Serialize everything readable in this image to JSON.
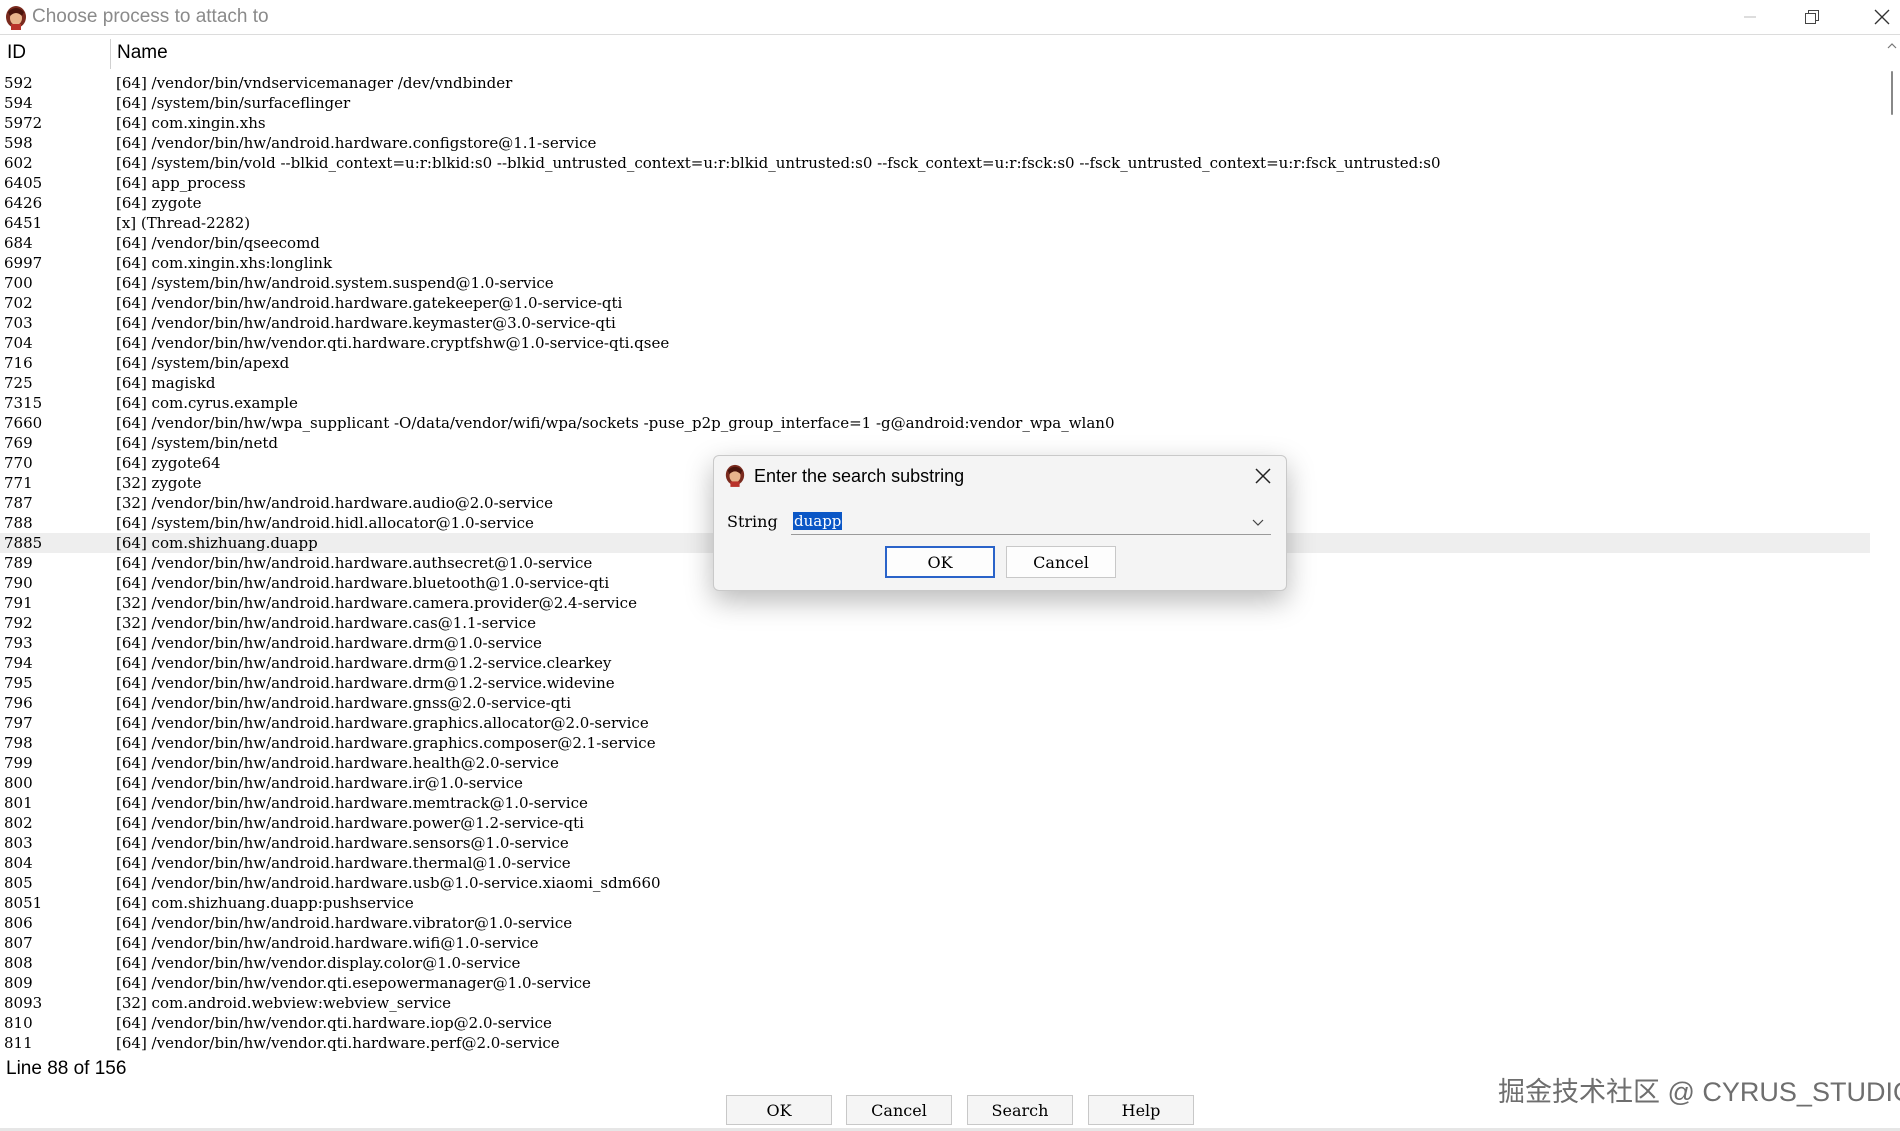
{
  "window": {
    "title": "Choose process to attach to"
  },
  "list": {
    "headers": {
      "id": "ID",
      "name": "Name"
    },
    "rows": [
      {
        "id": "592",
        "name": "[64] /vendor/bin/vndservicemanager /dev/vndbinder"
      },
      {
        "id": "594",
        "name": "[64] /system/bin/surfaceflinger"
      },
      {
        "id": "5972",
        "name": "[64] com.xingin.xhs"
      },
      {
        "id": "598",
        "name": "[64] /vendor/bin/hw/android.hardware.configstore@1.1-service"
      },
      {
        "id": "602",
        "name": "[64] /system/bin/vold --blkid_context=u:r:blkid:s0 --blkid_untrusted_context=u:r:blkid_untrusted:s0 --fsck_context=u:r:fsck:s0 --fsck_untrusted_context=u:r:fsck_untrusted:s0"
      },
      {
        "id": "6405",
        "name": "[64] app_process"
      },
      {
        "id": "6426",
        "name": "[64] zygote"
      },
      {
        "id": "6451",
        "name": "[x] (Thread-2282)"
      },
      {
        "id": "684",
        "name": "[64] /vendor/bin/qseecomd"
      },
      {
        "id": "6997",
        "name": "[64] com.xingin.xhs:longlink"
      },
      {
        "id": "700",
        "name": "[64] /system/bin/hw/android.system.suspend@1.0-service"
      },
      {
        "id": "702",
        "name": "[64] /vendor/bin/hw/android.hardware.gatekeeper@1.0-service-qti"
      },
      {
        "id": "703",
        "name": "[64] /vendor/bin/hw/android.hardware.keymaster@3.0-service-qti"
      },
      {
        "id": "704",
        "name": "[64] /vendor/bin/hw/vendor.qti.hardware.cryptfshw@1.0-service-qti.qsee"
      },
      {
        "id": "716",
        "name": "[64] /system/bin/apexd"
      },
      {
        "id": "725",
        "name": "[64] magiskd"
      },
      {
        "id": "7315",
        "name": "[64] com.cyrus.example"
      },
      {
        "id": "7660",
        "name": "[64] /vendor/bin/hw/wpa_supplicant -O/data/vendor/wifi/wpa/sockets -puse_p2p_group_interface=1 -g@android:vendor_wpa_wlan0"
      },
      {
        "id": "769",
        "name": "[64] /system/bin/netd"
      },
      {
        "id": "770",
        "name": "[64] zygote64"
      },
      {
        "id": "771",
        "name": "[32] zygote"
      },
      {
        "id": "787",
        "name": "[32] /vendor/bin/hw/android.hardware.audio@2.0-service"
      },
      {
        "id": "788",
        "name": "[64] /system/bin/hw/android.hidl.allocator@1.0-service"
      },
      {
        "id": "7885",
        "name": "[64] com.shizhuang.duapp",
        "selected": true
      },
      {
        "id": "789",
        "name": "[64] /vendor/bin/hw/android.hardware.authsecret@1.0-service"
      },
      {
        "id": "790",
        "name": "[64] /vendor/bin/hw/android.hardware.bluetooth@1.0-service-qti"
      },
      {
        "id": "791",
        "name": "[32] /vendor/bin/hw/android.hardware.camera.provider@2.4-service"
      },
      {
        "id": "792",
        "name": "[32] /vendor/bin/hw/android.hardware.cas@1.1-service"
      },
      {
        "id": "793",
        "name": "[64] /vendor/bin/hw/android.hardware.drm@1.0-service"
      },
      {
        "id": "794",
        "name": "[64] /vendor/bin/hw/android.hardware.drm@1.2-service.clearkey"
      },
      {
        "id": "795",
        "name": "[64] /vendor/bin/hw/android.hardware.drm@1.2-service.widevine"
      },
      {
        "id": "796",
        "name": "[64] /vendor/bin/hw/android.hardware.gnss@2.0-service-qti"
      },
      {
        "id": "797",
        "name": "[64] /vendor/bin/hw/android.hardware.graphics.allocator@2.0-service"
      },
      {
        "id": "798",
        "name": "[64] /vendor/bin/hw/android.hardware.graphics.composer@2.1-service"
      },
      {
        "id": "799",
        "name": "[64] /vendor/bin/hw/android.hardware.health@2.0-service"
      },
      {
        "id": "800",
        "name": "[64] /vendor/bin/hw/android.hardware.ir@1.0-service"
      },
      {
        "id": "801",
        "name": "[64] /vendor/bin/hw/android.hardware.memtrack@1.0-service"
      },
      {
        "id": "802",
        "name": "[64] /vendor/bin/hw/android.hardware.power@1.2-service-qti"
      },
      {
        "id": "803",
        "name": "[64] /vendor/bin/hw/android.hardware.sensors@1.0-service"
      },
      {
        "id": "804",
        "name": "[64] /vendor/bin/hw/android.hardware.thermal@1.0-service"
      },
      {
        "id": "805",
        "name": "[64] /vendor/bin/hw/android.hardware.usb@1.0-service.xiaomi_sdm660"
      },
      {
        "id": "8051",
        "name": "[64] com.shizhuang.duapp:pushservice"
      },
      {
        "id": "806",
        "name": "[64] /vendor/bin/hw/android.hardware.vibrator@1.0-service"
      },
      {
        "id": "807",
        "name": "[64] /vendor/bin/hw/android.hardware.wifi@1.0-service"
      },
      {
        "id": "808",
        "name": "[64] /vendor/bin/hw/vendor.display.color@1.0-service"
      },
      {
        "id": "809",
        "name": "[64] /vendor/bin/hw/vendor.qti.esepowermanager@1.0-service"
      },
      {
        "id": "8093",
        "name": "[32] com.android.webview:webview_service"
      },
      {
        "id": "810",
        "name": "[64] /vendor/bin/hw/vendor.qti.hardware.iop@2.0-service"
      },
      {
        "id": "811",
        "name": "[64] /vendor/bin/hw/vendor.qti.hardware.perf@2.0-service"
      }
    ]
  },
  "status": {
    "line_text": "Line 88 of 156"
  },
  "buttons": {
    "ok": "OK",
    "cancel": "Cancel",
    "search": "Search",
    "help": "Help"
  },
  "dialog": {
    "title": "Enter the search substring",
    "string_label": "String",
    "string_value": "duapp",
    "ok": "OK",
    "cancel": "Cancel"
  },
  "watermark": "掘金技术社区 @ CYRUS_STUDIO",
  "colors": {
    "selection": "#0b57c6",
    "selected_row": "#eeeeee",
    "default_button_border": "#2a63c9"
  }
}
